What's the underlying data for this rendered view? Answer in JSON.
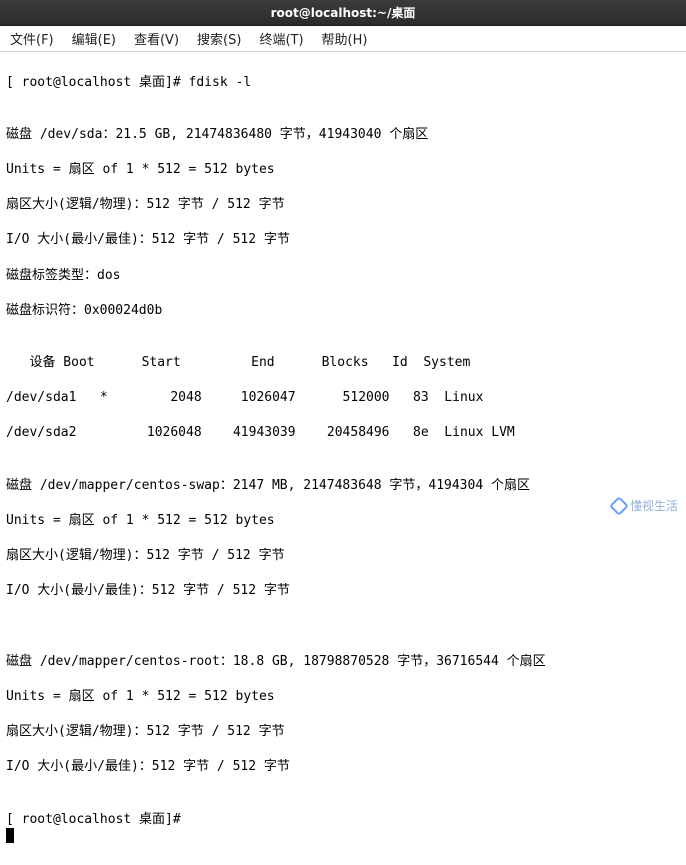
{
  "window": {
    "title": "root@localhost:~/桌面"
  },
  "menu": {
    "file": "文件(F)",
    "edit": "编辑(E)",
    "view": "查看(V)",
    "search": "搜索(S)",
    "terminal": "终端(T)",
    "help": "帮助(H)"
  },
  "prompt": {
    "line1": "[ root@localhost 桌面]# fdisk -l",
    "final": "[ root@localhost 桌面]# "
  },
  "output": {
    "blank": "",
    "disk_sda": "磁盘 /dev/sda：21.5 GB, 21474836480 字节，41943040 个扇区",
    "units": "Units = 扇区 of 1 * 512 = 512 bytes",
    "sector_size": "扇区大小(逻辑/物理)：512 字节 / 512 字节",
    "io_size": "I/O 大小(最小/最佳)：512 字节 / 512 字节",
    "label_type": "磁盘标签类型：dos",
    "identifier": "磁盘标识符：0x00024d0b",
    "table_header": "   设备 Boot      Start         End      Blocks   Id  System",
    "row1": "/dev/sda1   *        2048     1026047      512000   83  Linux",
    "row2": "/dev/sda2         1026048    41943039    20458496   8e  Linux LVM",
    "disk_swap": "磁盘 /dev/mapper/centos-swap：2147 MB, 2147483648 字节，4194304 个扇区",
    "units2": "Units = 扇区 of 1 * 512 = 512 bytes",
    "sector_size2": "扇区大小(逻辑/物理)：512 字节 / 512 字节",
    "io_size2": "I/O 大小(最小/最佳)：512 字节 / 512 字节",
    "disk_root": "磁盘 /dev/mapper/centos-root：18.8 GB, 18798870528 字节，36716544 个扇区",
    "units3": "Units = 扇区 of 1 * 512 = 512 bytes",
    "sector_size3": "扇区大小(逻辑/物理)：512 字节 / 512 字节",
    "io_size3": "I/O 大小(最小/最佳)：512 字节 / 512 字节"
  },
  "partition_table": {
    "columns": [
      "设备",
      "Boot",
      "Start",
      "End",
      "Blocks",
      "Id",
      "System"
    ],
    "rows": [
      {
        "device": "/dev/sda1",
        "boot": "*",
        "start": 2048,
        "end": 1026047,
        "blocks": 512000,
        "id": "83",
        "system": "Linux"
      },
      {
        "device": "/dev/sda2",
        "boot": "",
        "start": 1026048,
        "end": 41943039,
        "blocks": 20458496,
        "id": "8e",
        "system": "Linux LVM"
      }
    ]
  },
  "watermark": {
    "text": "懂视生活"
  }
}
